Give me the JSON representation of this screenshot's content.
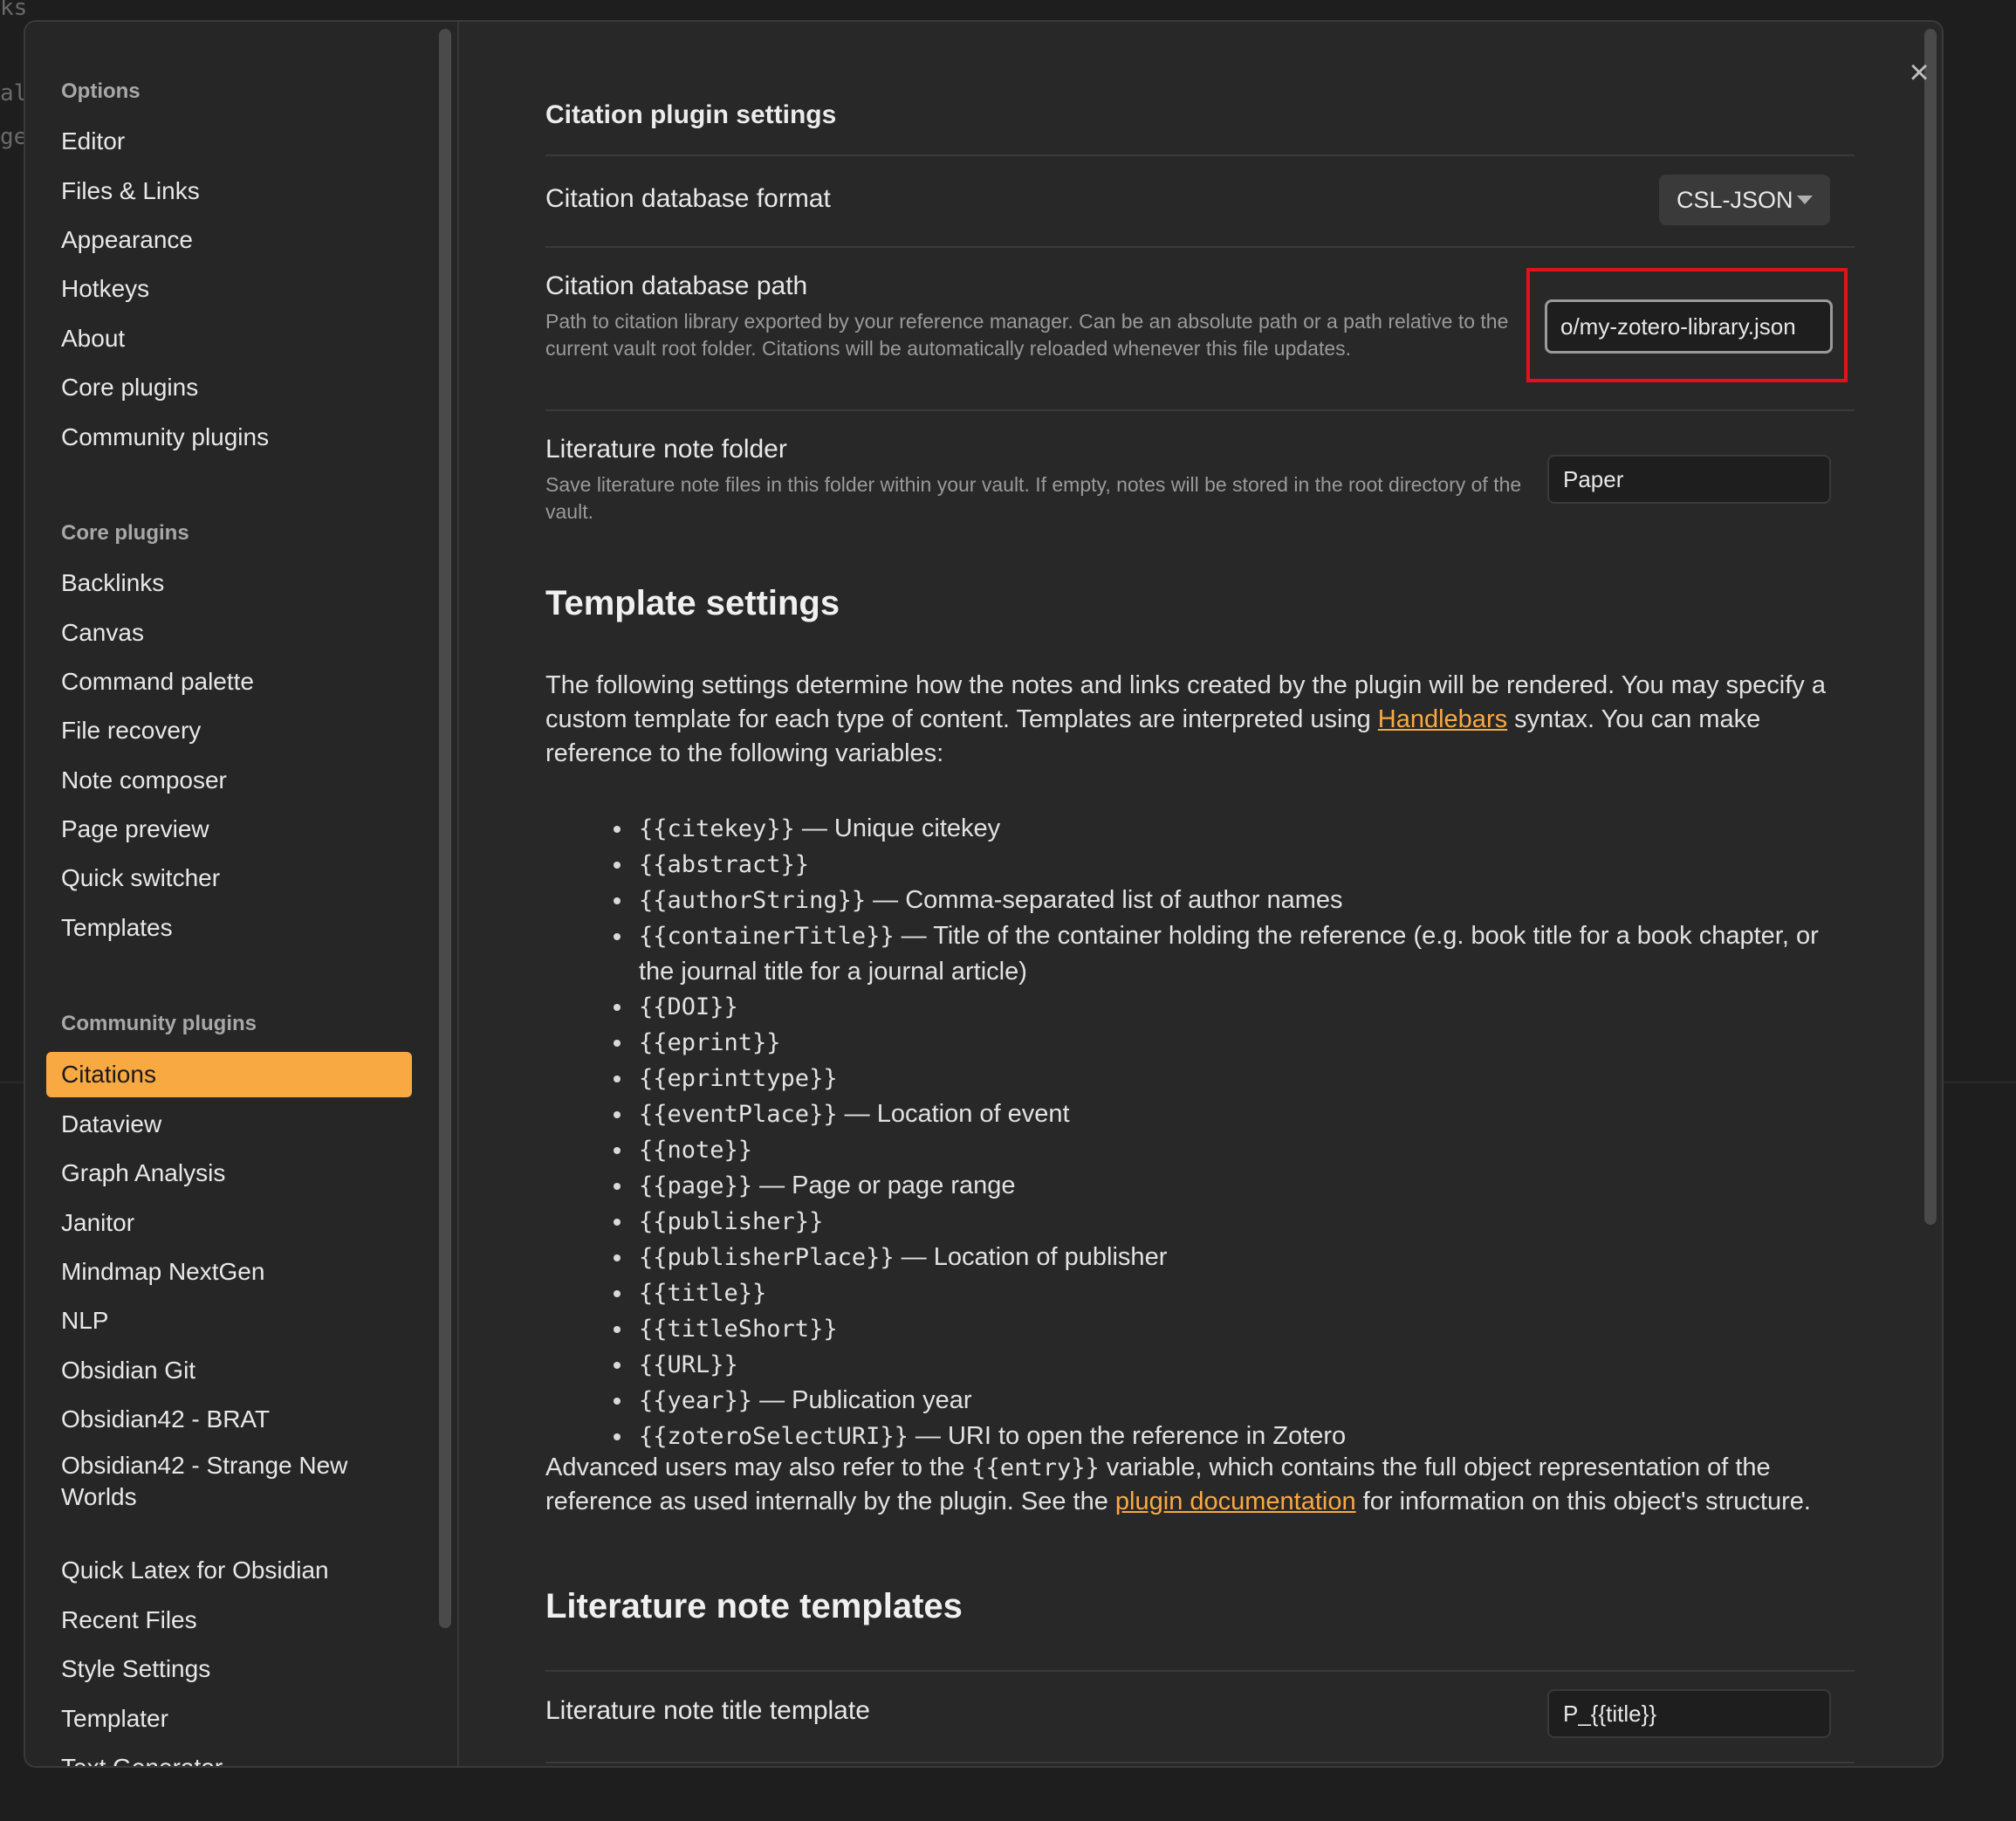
{
  "background": {
    "editor_fragments": [
      "ks",
      "al",
      "ge"
    ]
  },
  "sidebar": {
    "sections": [
      {
        "heading": "Options",
        "items": [
          "Editor",
          "Files & Links",
          "Appearance",
          "Hotkeys",
          "About",
          "Core plugins",
          "Community plugins"
        ]
      },
      {
        "heading": "Core plugins",
        "items": [
          "Backlinks",
          "Canvas",
          "Command palette",
          "File recovery",
          "Note composer",
          "Page preview",
          "Quick switcher",
          "Templates"
        ]
      },
      {
        "heading": "Community plugins",
        "items": [
          "Citations",
          "Dataview",
          "Graph Analysis",
          "Janitor",
          "Mindmap NextGen",
          "NLP",
          "Obsidian Git",
          "Obsidian42 - BRAT",
          "Obsidian42 - Strange New Worlds",
          "Quick Latex for Obsidian",
          "Recent Files",
          "Style Settings",
          "Templater",
          "Text Generator"
        ]
      }
    ],
    "active_item": "Citations",
    "accent_color": "#f9a942"
  },
  "content": {
    "title": "Citation plugin settings",
    "settings": {
      "db_format": {
        "name": "Citation database format",
        "value": "CSL-JSON"
      },
      "db_path": {
        "name": "Citation database path",
        "description": "Path to citation library exported by your reference manager. Can be an absolute path or a path relative to the current vault root folder. Citations will be automatically reloaded whenever this file updates.",
        "value": "o/my-zotero-library.json"
      },
      "lit_folder": {
        "name": "Literature note folder",
        "description": "Save literature note files in this folder within your vault. If empty, notes will be stored in the root directory of the vault.",
        "value": "Paper"
      },
      "lit_title_template": {
        "name": "Literature note title template",
        "value": "P_{{title}}"
      }
    },
    "template_heading": "Template settings",
    "template_intro": {
      "before_link": "The following settings determine how the notes and links created by the plugin will be rendered. You may specify a custom template for each type of content. Templates are interpreted using ",
      "link": "Handlebars",
      "after_link": " syntax. You can make reference to the following variables:"
    },
    "variables": [
      {
        "code": "{{citekey}}",
        "desc": " — Unique citekey"
      },
      {
        "code": "{{abstract}}",
        "desc": ""
      },
      {
        "code": "{{authorString}}",
        "desc": " — Comma-separated list of author names"
      },
      {
        "code": "{{containerTitle}}",
        "desc": " — Title of the container holding the reference (e.g. book title for a book chapter, or the journal title for a journal article)"
      },
      {
        "code": "{{DOI}}",
        "desc": ""
      },
      {
        "code": "{{eprint}}",
        "desc": ""
      },
      {
        "code": "{{eprinttype}}",
        "desc": ""
      },
      {
        "code": "{{eventPlace}}",
        "desc": " — Location of event"
      },
      {
        "code": "{{note}}",
        "desc": ""
      },
      {
        "code": "{{page}}",
        "desc": " — Page or page range"
      },
      {
        "code": "{{publisher}}",
        "desc": ""
      },
      {
        "code": "{{publisherPlace}}",
        "desc": " — Location of publisher"
      },
      {
        "code": "{{title}}",
        "desc": ""
      },
      {
        "code": "{{titleShort}}",
        "desc": ""
      },
      {
        "code": "{{URL}}",
        "desc": ""
      },
      {
        "code": "{{year}}",
        "desc": " — Publication year"
      },
      {
        "code": "{{zoteroSelectURI}}",
        "desc": " — URI to open the reference in Zotero"
      }
    ],
    "advanced": {
      "before_code": "Advanced users may also refer to the ",
      "code": "{{entry}}",
      "middle": " variable, which contains the full object representation of the reference as used internally by the plugin. See the ",
      "link": "plugin documentation",
      "after_link": " for information on this object's structure."
    },
    "lit_templates_heading": "Literature note templates"
  }
}
